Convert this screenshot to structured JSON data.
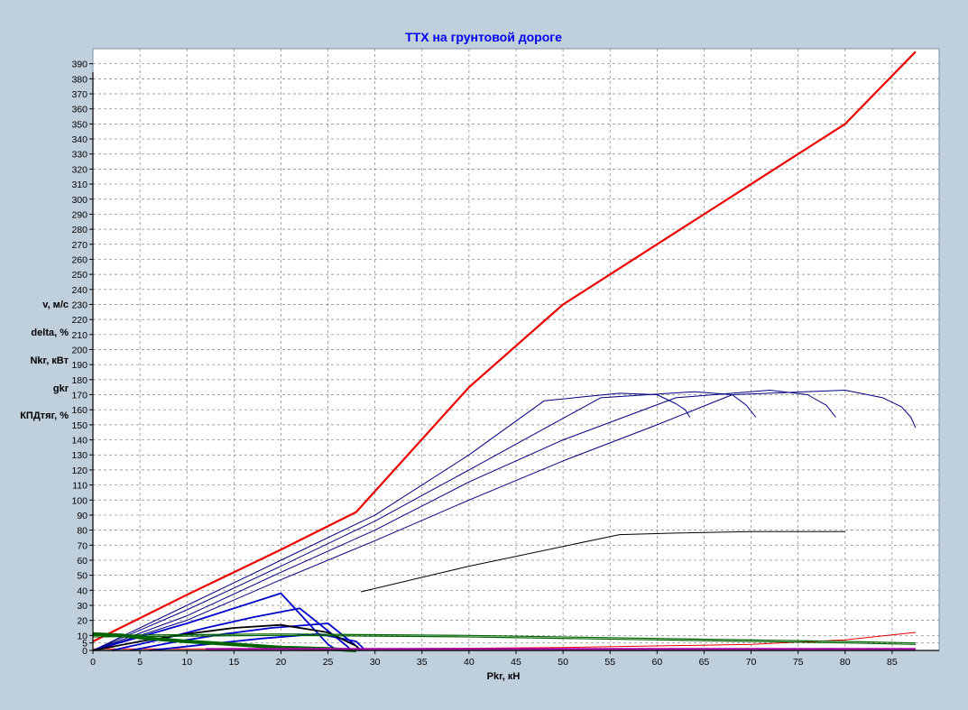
{
  "chart_data": {
    "type": "line",
    "title": "ТТХ на грунтовой дороге",
    "xlabel": "Pkr, кН",
    "ylabels": [
      "v, м/с",
      "delta, %",
      "Nkr, кВт",
      "gkr",
      "КПДтяг, %"
    ],
    "xlim": [
      0,
      90
    ],
    "ylim": [
      0,
      400
    ],
    "xticks": [
      0,
      5,
      10,
      15,
      20,
      25,
      30,
      35,
      40,
      45,
      50,
      55,
      60,
      65,
      70,
      75,
      80,
      85
    ],
    "yticks": [
      0,
      5,
      10,
      20,
      30,
      40,
      50,
      60,
      70,
      80,
      90,
      100,
      110,
      120,
      130,
      140,
      150,
      160,
      170,
      180,
      190,
      200,
      210,
      220,
      230,
      240,
      250,
      260,
      270,
      280,
      290,
      300,
      310,
      320,
      330,
      340,
      350,
      360,
      370,
      380,
      390
    ],
    "grid": true,
    "colors": {
      "background": "#c0cfdc",
      "plot_area": "#ffffff",
      "title": "#0000ee",
      "grid": "#808080"
    },
    "series": [
      {
        "color": "#ee0000",
        "width": 2.2,
        "points": [
          [
            0,
            6
          ],
          [
            10,
            37
          ],
          [
            20,
            67
          ],
          [
            28,
            92
          ],
          [
            40,
            175
          ],
          [
            50,
            230
          ],
          [
            60,
            270
          ],
          [
            70,
            310
          ],
          [
            80,
            350
          ],
          [
            87.5,
            398
          ]
        ]
      },
      {
        "color": "#ee0000",
        "width": 1,
        "points": [
          [
            0,
            1
          ],
          [
            30,
            1
          ],
          [
            50,
            2
          ],
          [
            70,
            4
          ],
          [
            80,
            7
          ],
          [
            87.5,
            12
          ]
        ]
      },
      {
        "color": "#000080",
        "width": 1,
        "points": [
          [
            0,
            0
          ],
          [
            10,
            30
          ],
          [
            20,
            60
          ],
          [
            30,
            90
          ],
          [
            40,
            130
          ],
          [
            48,
            166
          ],
          [
            56,
            171
          ],
          [
            60,
            170
          ],
          [
            62,
            164
          ],
          [
            63,
            160
          ],
          [
            63.5,
            155
          ]
        ]
      },
      {
        "color": "#000080",
        "width": 1,
        "points": [
          [
            0,
            0
          ],
          [
            10,
            27
          ],
          [
            20,
            56
          ],
          [
            30,
            86
          ],
          [
            40,
            120
          ],
          [
            54,
            168
          ],
          [
            64,
            172
          ],
          [
            68,
            170
          ],
          [
            69.5,
            163
          ],
          [
            70.5,
            155
          ]
        ]
      },
      {
        "color": "#000080",
        "width": 1,
        "points": [
          [
            0,
            0
          ],
          [
            10,
            23
          ],
          [
            20,
            52
          ],
          [
            30,
            80
          ],
          [
            40,
            112
          ],
          [
            50,
            140
          ],
          [
            62,
            168
          ],
          [
            72,
            173
          ],
          [
            76,
            170
          ],
          [
            78,
            163
          ],
          [
            79,
            155
          ]
        ]
      },
      {
        "color": "#000080",
        "width": 1,
        "points": [
          [
            0,
            0
          ],
          [
            10,
            20
          ],
          [
            20,
            47
          ],
          [
            30,
            73
          ],
          [
            40,
            100
          ],
          [
            50,
            126
          ],
          [
            60,
            150
          ],
          [
            68,
            170
          ],
          [
            80,
            173
          ],
          [
            84,
            168
          ],
          [
            86,
            162
          ],
          [
            87,
            155
          ],
          [
            87.5,
            148
          ]
        ]
      },
      {
        "color": "#000000",
        "width": 1,
        "points": [
          [
            28.5,
            39
          ],
          [
            40,
            56
          ],
          [
            56,
            77
          ],
          [
            62,
            78
          ],
          [
            70,
            79
          ],
          [
            80,
            79
          ]
        ]
      },
      {
        "color": "#0000cc",
        "width": 1.8,
        "points": [
          [
            0,
            0
          ],
          [
            5,
            9
          ],
          [
            10,
            18
          ],
          [
            15,
            28
          ],
          [
            20,
            38
          ],
          [
            25,
            4
          ],
          [
            26,
            0
          ]
        ]
      },
      {
        "color": "#0000cc",
        "width": 1.8,
        "points": [
          [
            2,
            0
          ],
          [
            7,
            7
          ],
          [
            12,
            15
          ],
          [
            17,
            22
          ],
          [
            22,
            28
          ],
          [
            27,
            3
          ],
          [
            27.5,
            0
          ]
        ]
      },
      {
        "color": "#0000cc",
        "width": 1.8,
        "points": [
          [
            4,
            0
          ],
          [
            9,
            6
          ],
          [
            14,
            11
          ],
          [
            19,
            15
          ],
          [
            25,
            18
          ],
          [
            28,
            3
          ],
          [
            28.5,
            0
          ]
        ]
      },
      {
        "color": "#0000cc",
        "width": 1.8,
        "points": [
          [
            6,
            0
          ],
          [
            12,
            4
          ],
          [
            18,
            8
          ],
          [
            24,
            11
          ],
          [
            28,
            6
          ],
          [
            29,
            0
          ]
        ]
      },
      {
        "color": "#000000",
        "width": 1.8,
        "points": [
          [
            0,
            0
          ],
          [
            5,
            6
          ],
          [
            10,
            11
          ],
          [
            15,
            15
          ],
          [
            20,
            17
          ],
          [
            25,
            12
          ],
          [
            28,
            3
          ],
          [
            28.5,
            0
          ]
        ]
      },
      {
        "color": "#006400",
        "width": 4,
        "points": [
          [
            0,
            11
          ],
          [
            3,
            10
          ],
          [
            6,
            8
          ],
          [
            10,
            6
          ],
          [
            15,
            4
          ],
          [
            20,
            2
          ],
          [
            25,
            1
          ],
          [
            28,
            0
          ]
        ]
      },
      {
        "color": "#006400",
        "width": 1.2,
        "points": [
          [
            0,
            10
          ],
          [
            20,
            11
          ],
          [
            40,
            10
          ],
          [
            60,
            8
          ],
          [
            80,
            6
          ],
          [
            87.5,
            5
          ]
        ]
      },
      {
        "color": "#006400",
        "width": 1.2,
        "points": [
          [
            0,
            9
          ],
          [
            20,
            10
          ],
          [
            40,
            9
          ],
          [
            60,
            7
          ],
          [
            80,
            5
          ],
          [
            87.5,
            4
          ]
        ]
      },
      {
        "color": "#808080",
        "width": 1.5,
        "points": [
          [
            0,
            0
          ],
          [
            87.5,
            0
          ]
        ]
      },
      {
        "color": "#aa00aa",
        "width": 2,
        "points": [
          [
            12,
            1
          ],
          [
            50,
            1
          ],
          [
            87.5,
            1
          ]
        ]
      }
    ]
  }
}
